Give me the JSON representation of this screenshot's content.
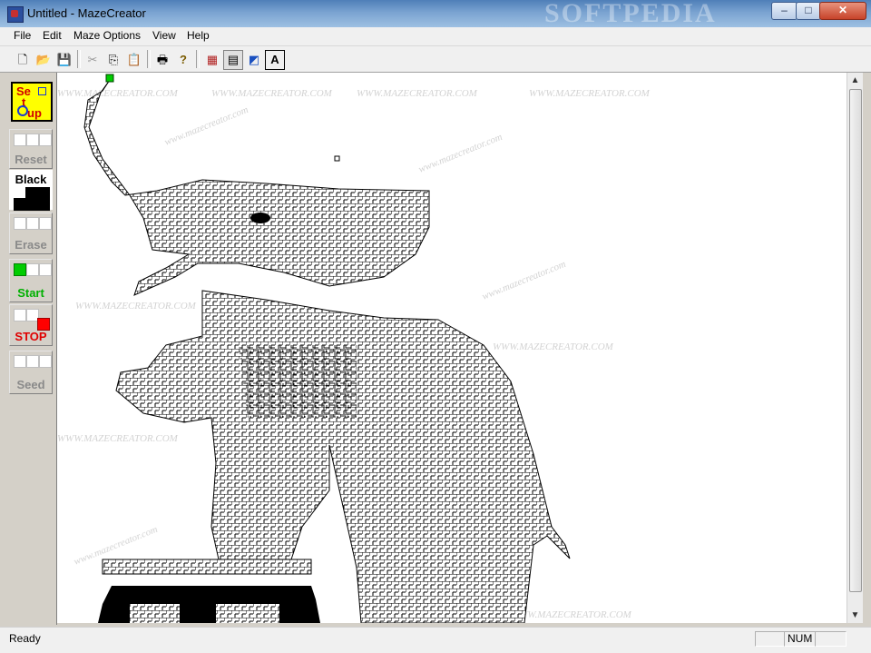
{
  "window": {
    "title": "Untitled - MazeCreator",
    "watermark": "SOFTPEDIA",
    "controls": {
      "minimize": "–",
      "maximize": "□",
      "close": "✕"
    }
  },
  "menubar": {
    "items": [
      {
        "label": "File"
      },
      {
        "label": "Edit"
      },
      {
        "label": "Maze Options"
      },
      {
        "label": "View"
      },
      {
        "label": "Help"
      }
    ]
  },
  "toolbar": {
    "buttons": [
      {
        "name": "new-file-icon",
        "glyph": "🗋"
      },
      {
        "name": "open-folder-icon",
        "glyph": "📂"
      },
      {
        "name": "save-icon",
        "glyph": "💾"
      },
      {
        "name": "cut-icon",
        "glyph": "✂"
      },
      {
        "name": "copy-icon",
        "glyph": "⎘"
      },
      {
        "name": "paste-icon",
        "glyph": "📋"
      },
      {
        "name": "print-icon",
        "glyph": "🖶"
      },
      {
        "name": "help-icon",
        "glyph": "?"
      },
      {
        "name": "maze-image-icon",
        "glyph": "▦"
      },
      {
        "name": "grid-view-icon",
        "glyph": "▤"
      },
      {
        "name": "color-picture-icon",
        "glyph": "◩"
      },
      {
        "name": "text-icon",
        "glyph": "A"
      }
    ]
  },
  "sidepanel": {
    "setup": {
      "label_lines": [
        "Se",
        "t",
        "up"
      ]
    },
    "reset": {
      "label": "Reset"
    },
    "black": {
      "label": "Black"
    },
    "erase": {
      "label": "Erase"
    },
    "start": {
      "label": "Start"
    },
    "stop": {
      "label": "STOP"
    },
    "seed": {
      "label": "Seed"
    }
  },
  "canvas": {
    "watermark_texts": [
      "WWW.MAZECREATOR.COM",
      "www.mazecreator.com"
    ]
  },
  "status": {
    "text": "Ready",
    "num": "NUM"
  },
  "colors": {
    "start_green": "#00cc00",
    "stop_red": "#ff0000",
    "setup_yellow": "#ffff00"
  }
}
